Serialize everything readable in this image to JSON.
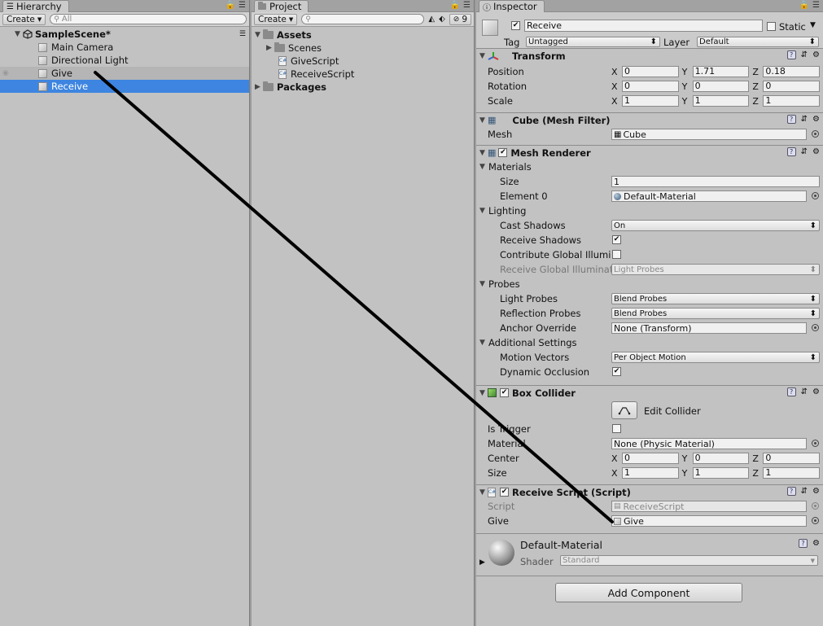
{
  "hierarchy": {
    "tab_label": "Hierarchy",
    "create_label": "Create",
    "search_placeholder": "All",
    "scene": "SampleScene*",
    "items": [
      {
        "label": "Main Camera"
      },
      {
        "label": "Directional Light"
      },
      {
        "label": "Give"
      },
      {
        "label": "Receive"
      }
    ]
  },
  "project": {
    "tab_label": "Project",
    "create_label": "Create",
    "hidden_count": "9",
    "assets_label": "Assets",
    "scenes_label": "Scenes",
    "give_script": "GiveScript",
    "receive_script": "ReceiveScript",
    "packages_label": "Packages",
    "script_badge": "C#"
  },
  "inspector": {
    "tab_label": "Inspector",
    "object_name": "Receive",
    "static_label": "Static",
    "tag_label": "Tag",
    "tag_value": "Untagged",
    "layer_label": "Layer",
    "layer_value": "Default",
    "transform": {
      "title": "Transform",
      "position_label": "Position",
      "rotation_label": "Rotation",
      "scale_label": "Scale",
      "x": "X",
      "y": "Y",
      "z": "Z",
      "position": [
        "0",
        "1.71",
        "0.18"
      ],
      "rotation": [
        "0",
        "0",
        "0"
      ],
      "scale": [
        "1",
        "1",
        "1"
      ]
    },
    "mesh_filter": {
      "title": "Cube (Mesh Filter)",
      "mesh_label": "Mesh",
      "mesh_value": "Cube"
    },
    "mesh_renderer": {
      "title": "Mesh Renderer",
      "materials_label": "Materials",
      "size_label": "Size",
      "size_value": "1",
      "element0_label": "Element 0",
      "element0_value": "Default-Material",
      "lighting_label": "Lighting",
      "cast_shadows_label": "Cast Shadows",
      "cast_shadows_value": "On",
      "receive_shadows_label": "Receive Shadows",
      "contribute_gi_label": "Contribute Global Illumi",
      "receive_gi_label": "Receive Global Illuminat",
      "receive_gi_value": "Light Probes",
      "probes_label": "Probes",
      "light_probes_label": "Light Probes",
      "light_probes_value": "Blend Probes",
      "reflection_probes_label": "Reflection Probes",
      "reflection_probes_value": "Blend Probes",
      "anchor_override_label": "Anchor Override",
      "anchor_override_value": "None (Transform)",
      "additional_label": "Additional Settings",
      "motion_vectors_label": "Motion Vectors",
      "motion_vectors_value": "Per Object Motion",
      "dynamic_occlusion_label": "Dynamic Occlusion"
    },
    "box_collider": {
      "title": "Box Collider",
      "edit_label": "Edit Collider",
      "is_trigger_label": "Is Trigger",
      "material_label": "Material",
      "material_value": "None (Physic Material)",
      "center_label": "Center",
      "size_label": "Size",
      "center": [
        "0",
        "0",
        "0"
      ],
      "size": [
        "1",
        "1",
        "1"
      ]
    },
    "receive_script": {
      "title": "Receive Script (Script)",
      "script_label": "Script",
      "script_value": "ReceiveScript",
      "give_label": "Give",
      "give_value": "Give"
    },
    "material": {
      "name": "Default-Material",
      "shader_label": "Shader",
      "shader_value": "Standard"
    },
    "add_component_label": "Add Component"
  },
  "check_glyph": "✔",
  "colors": {
    "selection": "#3d85e0",
    "panel": "#c2c2c2",
    "annotation_line": "#000000"
  }
}
